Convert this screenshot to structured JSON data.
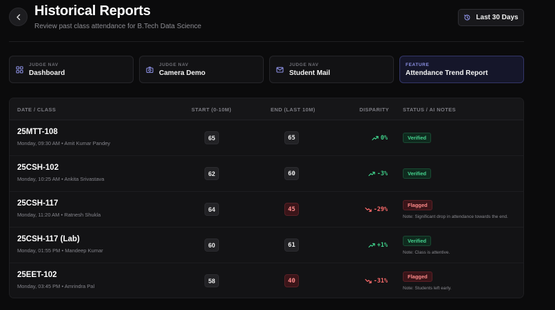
{
  "header": {
    "title": "Historical Reports",
    "subtitle": "Review past class attendance for B.Tech Data Science",
    "range_label": "Last 30 Days"
  },
  "nav_cards": [
    {
      "kicker": "JUDGE NAV",
      "label": "Dashboard",
      "icon": "grid-icon"
    },
    {
      "kicker": "JUDGE NAV",
      "label": "Camera Demo",
      "icon": "camera-icon"
    },
    {
      "kicker": "JUDGE NAV",
      "label": "Student Mail",
      "icon": "mail-icon"
    },
    {
      "kicker": "FEATURE",
      "label": "Attendance Trend Report",
      "active": true
    }
  ],
  "table": {
    "columns": [
      "DATE / CLASS",
      "START (0-10M)",
      "END (LAST 10M)",
      "DISPARITY",
      "STATUS / AI NOTES"
    ],
    "rows": [
      {
        "class": "25MTT-108",
        "meta": "Monday, 09:30 AM • Amit Kumar Pandey",
        "start": "65",
        "end": "65",
        "end_bad": false,
        "disparity": "0%",
        "trend": "up",
        "status": "Verified",
        "note": ""
      },
      {
        "class": "25CSH-102",
        "meta": "Monday, 10:25 AM • Ankita Srivastava",
        "start": "62",
        "end": "60",
        "end_bad": false,
        "disparity": "-3%",
        "trend": "up",
        "status": "Verified",
        "note": ""
      },
      {
        "class": "25CSH-117",
        "meta": "Monday, 11:20 AM • Ratnesh Shukla",
        "start": "64",
        "end": "45",
        "end_bad": true,
        "disparity": "-29%",
        "trend": "down",
        "status": "Flagged",
        "note": "Note: Significant drop in attendance towards the end."
      },
      {
        "class": "25CSH-117 (Lab)",
        "meta": "Monday, 01:55 PM • Mandeep Kumar",
        "start": "60",
        "end": "61",
        "end_bad": false,
        "disparity": "+1%",
        "trend": "up",
        "status": "Verified",
        "note": "Note: Class is attentive."
      },
      {
        "class": "25EET-102",
        "meta": "Monday, 03:45 PM • Amrindra Pal",
        "start": "58",
        "end": "40",
        "end_bad": true,
        "disparity": "-31%",
        "trend": "down",
        "status": "Flagged",
        "note": "Note: Students left early."
      }
    ]
  },
  "colors": {
    "background": "#0b0b0c",
    "positive": "#3fd08a",
    "negative": "#ff6b6b",
    "feature_accent": "#8d92e6"
  }
}
